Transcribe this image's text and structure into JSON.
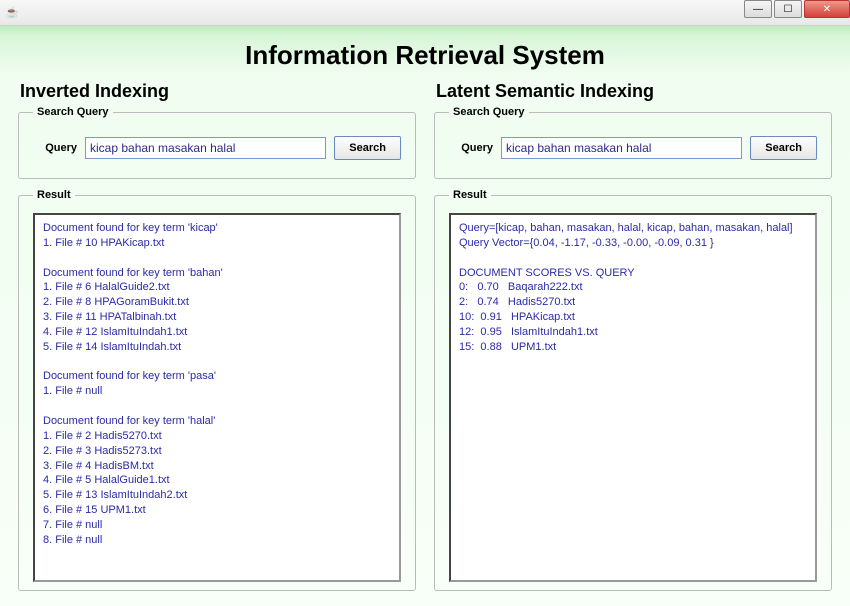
{
  "window": {
    "java_icon": "☕",
    "controls": {
      "min": "—",
      "max": "☐",
      "close": "✕"
    }
  },
  "title": "Information Retrieval System",
  "left": {
    "heading": "Inverted Indexing",
    "search_legend": "Search Query",
    "query_label": "Query",
    "query_value": "kicap bahan masakan halal",
    "search_btn": "Search",
    "result_legend": "Result",
    "result_text": "Document found for key term 'kicap'\n1. File # 10 HPAKicap.txt\n\nDocument found for key term 'bahan'\n1. File # 6 HalalGuide2.txt\n2. File # 8 HPAGoramBukit.txt\n3. File # 11 HPATalbinah.txt\n4. File # 12 IslamItuIndah1.txt\n5. File # 14 IslamItuIndah.txt\n\nDocument found for key term 'pasa'\n1. File # null\n\nDocument found for key term 'halal'\n1. File # 2 Hadis5270.txt\n2. File # 3 Hadis5273.txt\n3. File # 4 HadisBM.txt\n4. File # 5 HalalGuide1.txt\n5. File # 13 IslamItuIndah2.txt\n6. File # 15 UPM1.txt\n7. File # null\n8. File # null"
  },
  "right": {
    "heading": "Latent Semantic Indexing",
    "search_legend": "Search Query",
    "query_label": "Query",
    "query_value": "kicap bahan masakan halal",
    "search_btn": "Search",
    "result_legend": "Result",
    "result_text": "Query=[kicap, bahan, masakan, halal, kicap, bahan, masakan, halal]\nQuery Vector={0.04, -1.17, -0.33, -0.00, -0.09, 0.31 }\n\nDOCUMENT SCORES VS. QUERY\n0:   0.70   Baqarah222.txt\n2:   0.74   Hadis5270.txt\n10:  0.91   HPAKicap.txt\n12:  0.95   IslamItuIndah1.txt\n15:  0.88   UPM1.txt"
  }
}
